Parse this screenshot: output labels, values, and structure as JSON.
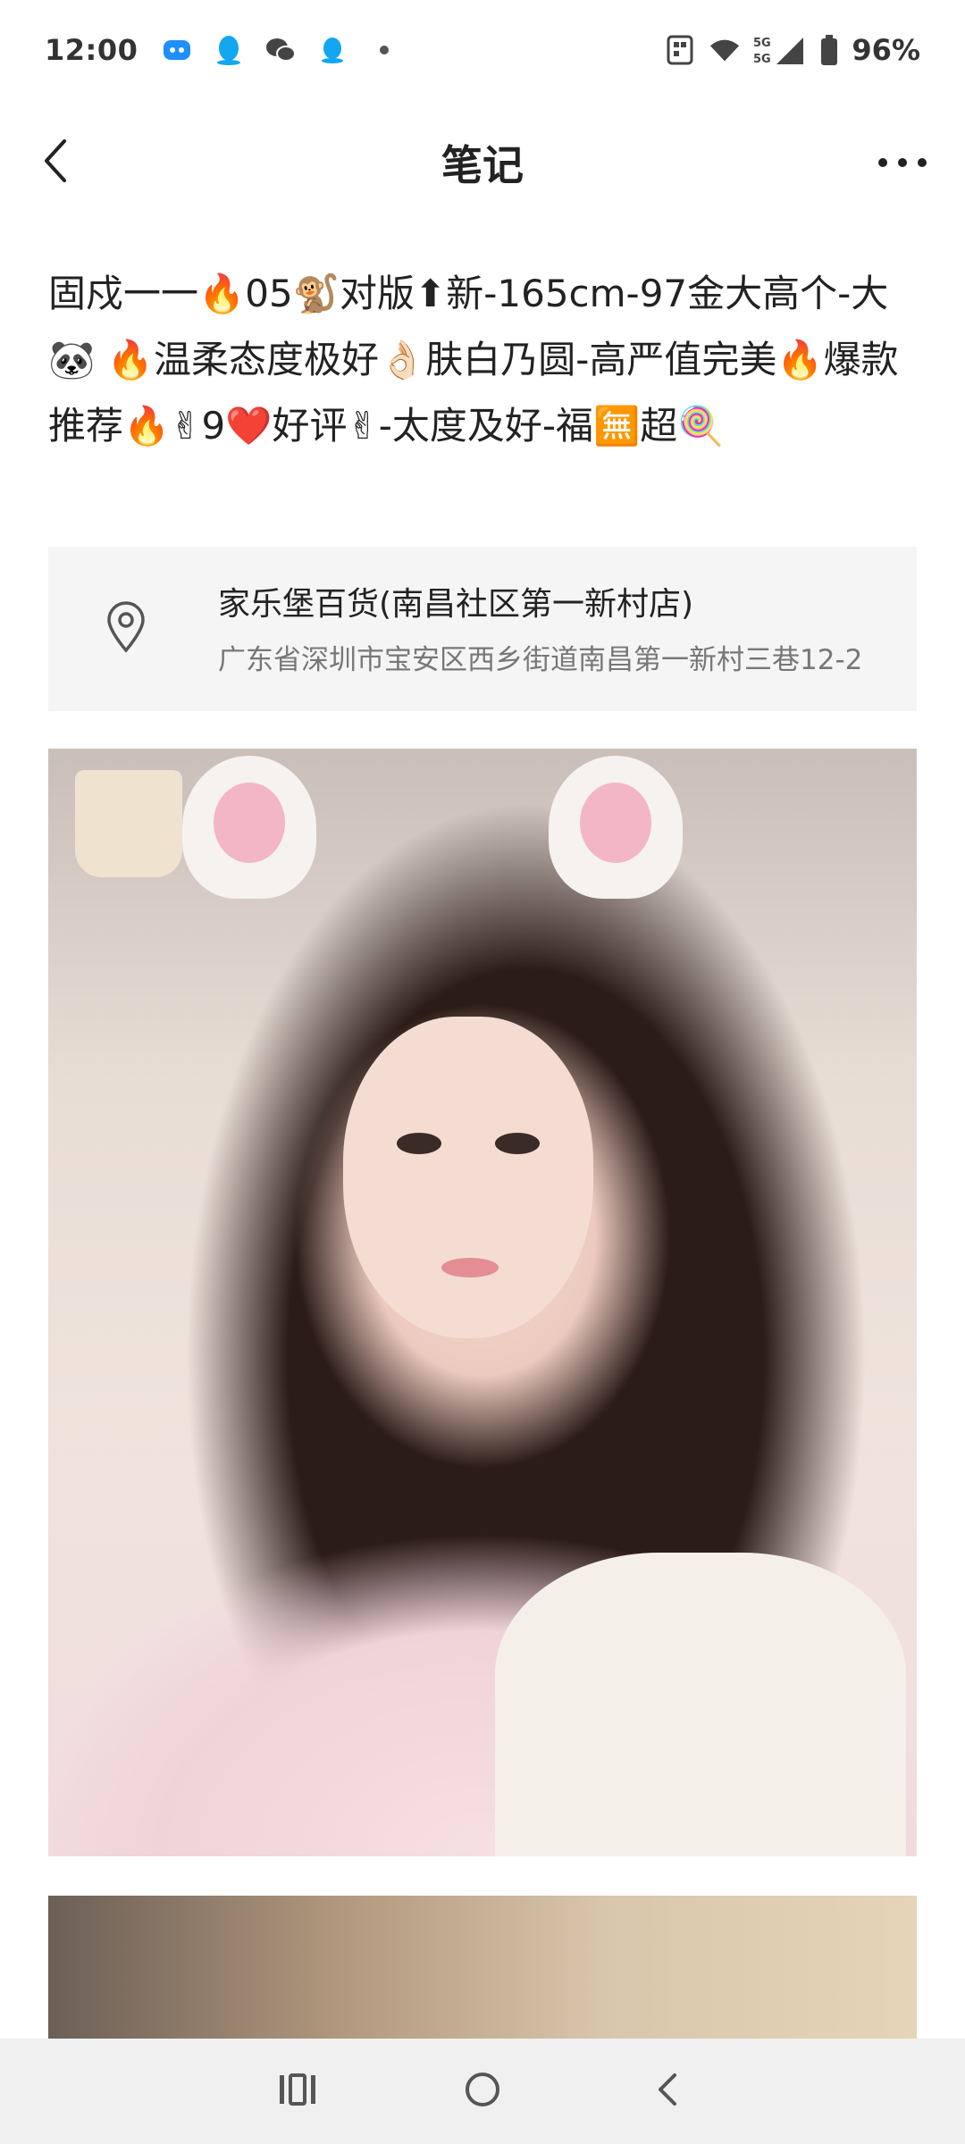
{
  "status_bar": {
    "time": "12:00",
    "network": "5G",
    "battery": "96%",
    "icons": [
      "bluebird-icon",
      "qq-icon",
      "wechat-icon",
      "qq-icon",
      "dot-icon",
      "nfc-icon",
      "wifi-icon",
      "signal-icon",
      "battery-icon"
    ]
  },
  "header": {
    "title": "笔记",
    "back_icon": "back-chevron-icon",
    "more_icon": "more-dots-icon"
  },
  "note": {
    "text": "固戍一一🔥05🐒对版⬆新-165cm-97金大高个-大🐼 🔥温柔态度极好👌🏻肤白乃圆-高严值完美🔥爆款推荐🔥✌9❤️好评✌-太度及好-福🈚超🍭"
  },
  "location": {
    "name": "家乐堡百货(南昌社区第一新村店)",
    "address": "广东省深圳市宝安区西乡街道南昌第一新村三巷12-2",
    "icon": "location-pin-icon"
  },
  "photos": [
    {
      "description": "photo-1"
    },
    {
      "description": "photo-2"
    }
  ],
  "nav": {
    "recents_icon": "recents-icon",
    "home_icon": "home-icon",
    "back_icon": "nav-back-icon"
  }
}
